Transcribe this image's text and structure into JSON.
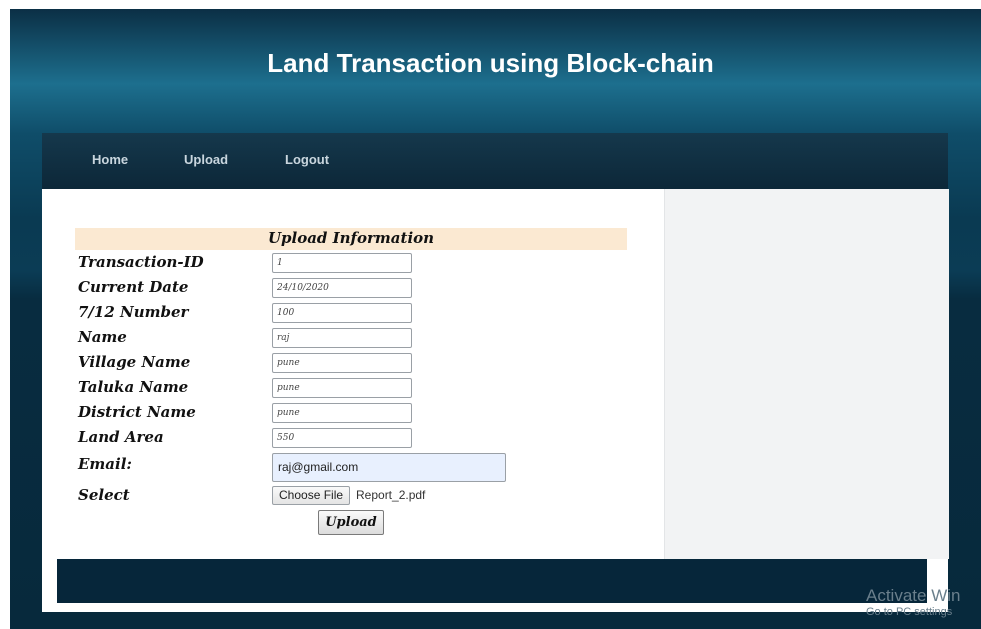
{
  "header": {
    "title": "Land Transaction using Block-chain"
  },
  "nav": {
    "items": [
      {
        "label": "Home"
      },
      {
        "label": "Upload"
      },
      {
        "label": "Logout"
      }
    ]
  },
  "form": {
    "title": "Upload Information",
    "fields": [
      {
        "label": "Transaction-ID",
        "value": "1"
      },
      {
        "label": "Current Date",
        "value": "24/10/2020"
      },
      {
        "label": "7/12 Number",
        "value": "100"
      },
      {
        "label": "Name",
        "value": "raj"
      },
      {
        "label": "Village Name",
        "value": "pune"
      },
      {
        "label": "Taluka Name",
        "value": "pune"
      },
      {
        "label": "District Name",
        "value": "pune"
      },
      {
        "label": "Land Area",
        "value": "550"
      }
    ],
    "email": {
      "label": "Email:",
      "value": "raj@gmail.com"
    },
    "select": {
      "label": "Select",
      "button": "Choose File",
      "file_name": "Report_2.pdf"
    },
    "submit_label": "Upload"
  },
  "watermark": {
    "title": "Activate Win",
    "subtitle": "Go to PC settings"
  },
  "colors": {
    "header_bg": "#1d6f8e",
    "nav_bg": "#15384c",
    "form_title_bg": "#fbe9d2",
    "footer_bg": "#06263a",
    "email_bg": "#e8f0fe"
  }
}
